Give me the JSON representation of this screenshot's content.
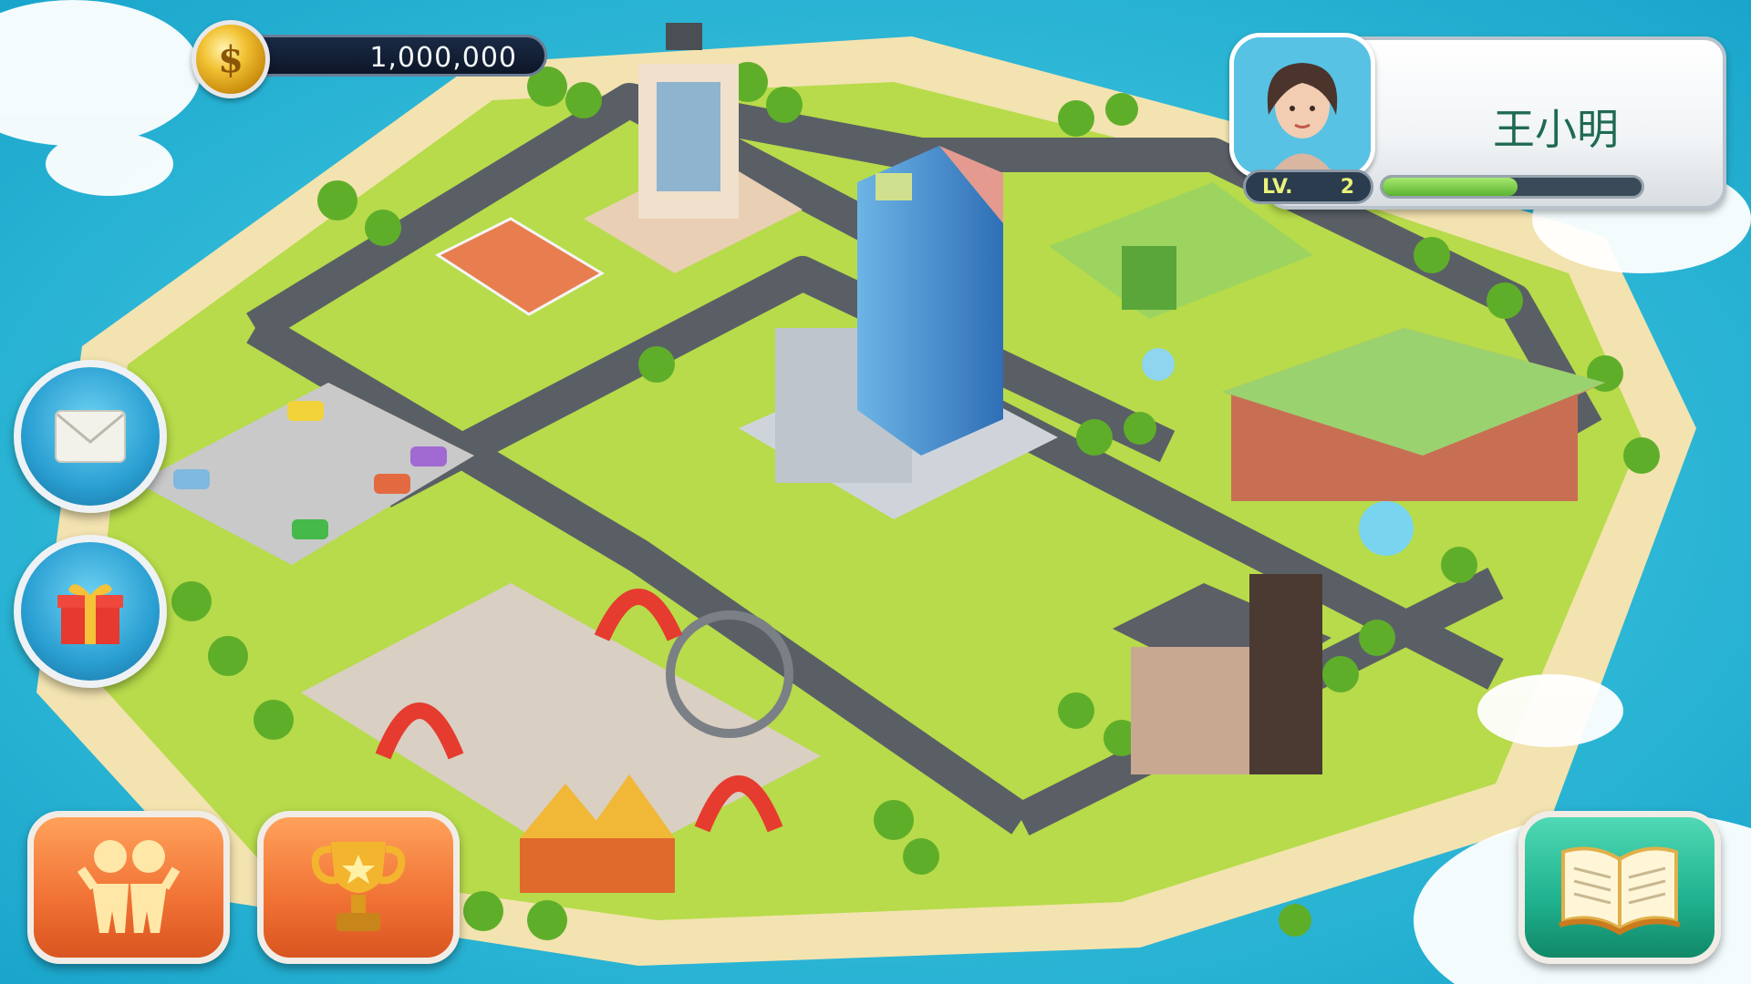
{
  "hud": {
    "coins": "1,000,000",
    "player_name": "王小明",
    "level_label": "LV.",
    "level": "2",
    "xp_progress": 0.52
  },
  "icons": {
    "coin": "coin-icon",
    "mail": "mail-icon",
    "gift": "gift-icon",
    "friends": "friends-icon",
    "trophy": "trophy-icon",
    "book": "book-icon"
  },
  "colors": {
    "ocean": "#26b8d6",
    "grass": "#b7db4a",
    "road": "#5a5f66",
    "orange_button": "#f07134",
    "teal_button": "#1fb18e",
    "name_text": "#1f6a52"
  }
}
